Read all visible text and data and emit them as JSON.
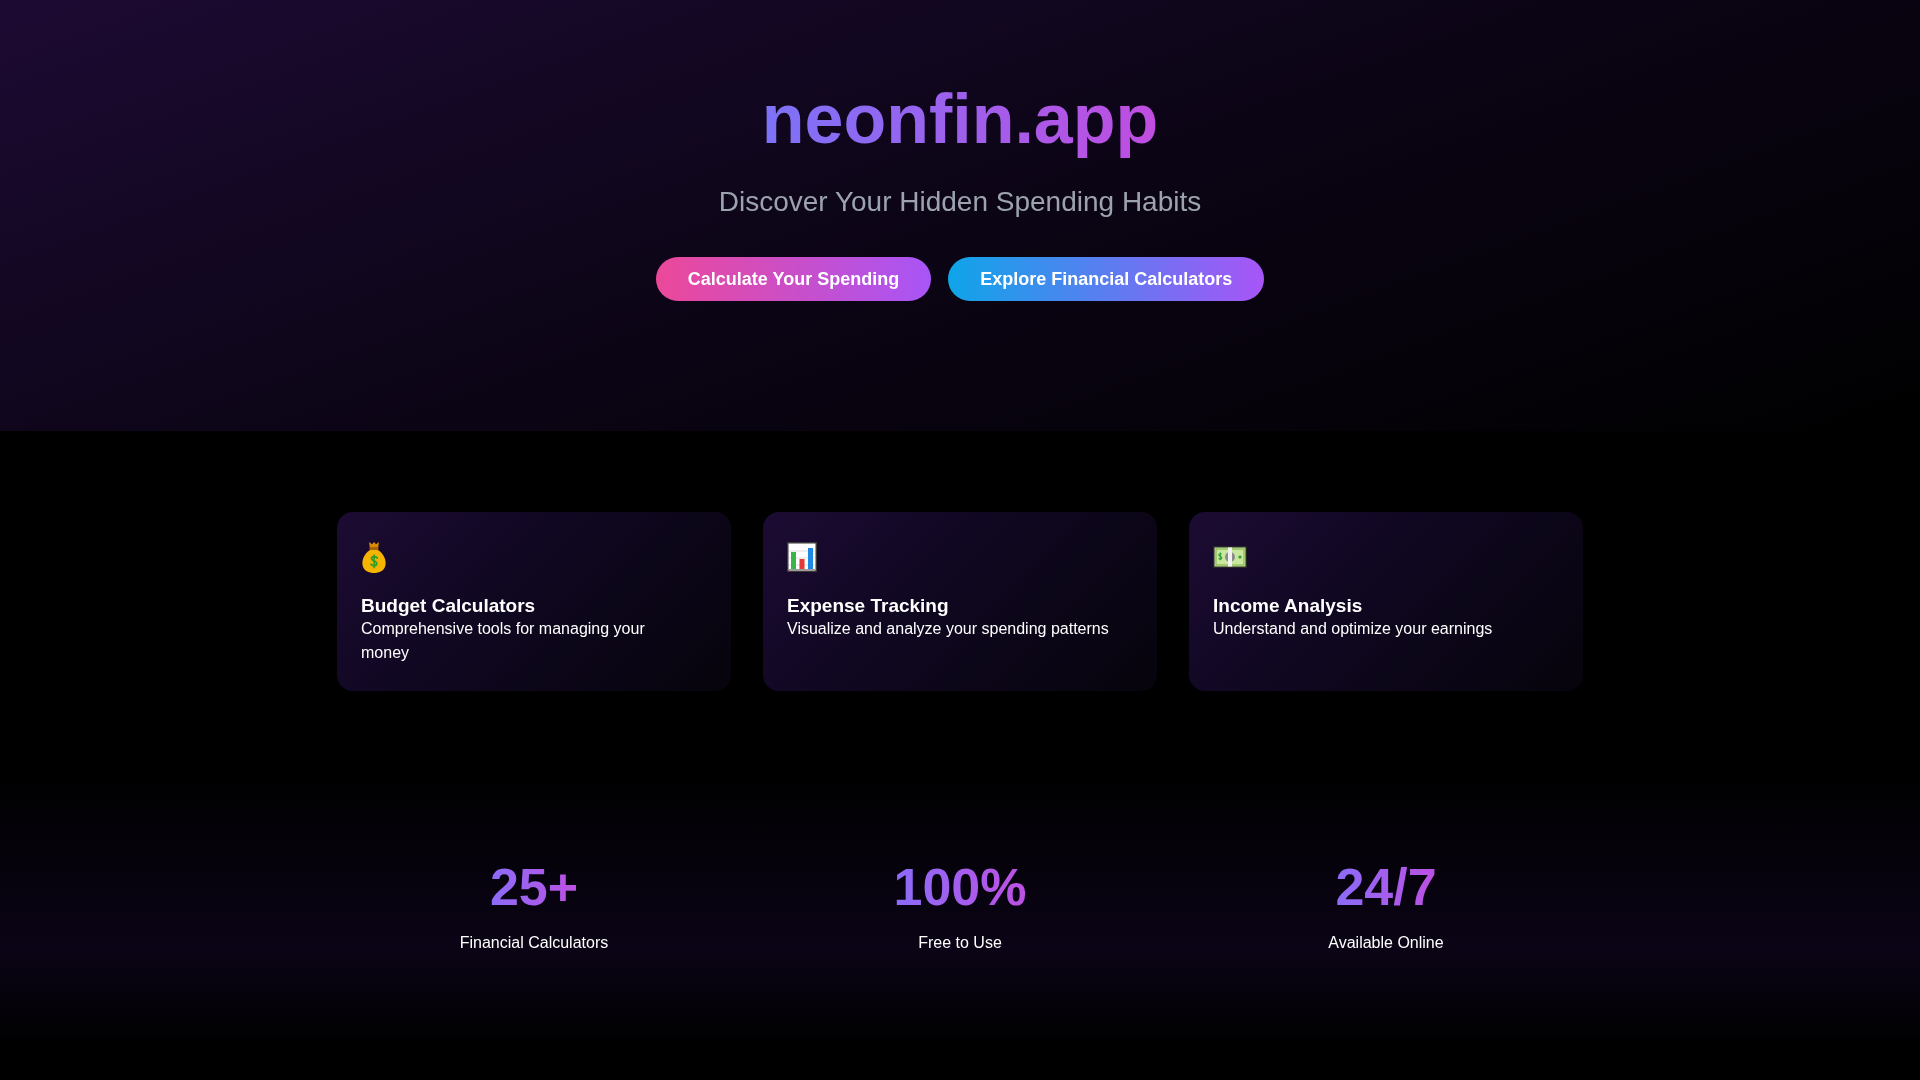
{
  "hero": {
    "title": "neonfin.app",
    "subtitle": "Discover Your Hidden Spending Habits",
    "buttons": [
      {
        "label": "Calculate Your Spending",
        "kind": "primary"
      },
      {
        "label": "Explore Financial Calculators",
        "kind": "secondary"
      }
    ]
  },
  "features": [
    {
      "kind": "money-bag",
      "title": "Budget Calculators",
      "description": "Comprehensive tools for managing your money"
    },
    {
      "kind": "bar-chart",
      "title": "Expense Tracking",
      "description": "Visualize and analyze your spending patterns"
    },
    {
      "kind": "banknote",
      "title": "Income Analysis",
      "description": "Understand and optimize your earnings"
    }
  ],
  "stats": [
    {
      "value": "25+",
      "label": "Financial Calculators"
    },
    {
      "value": "100%",
      "label": "Free to Use"
    },
    {
      "value": "24/7",
      "label": "Available Online"
    }
  ]
}
